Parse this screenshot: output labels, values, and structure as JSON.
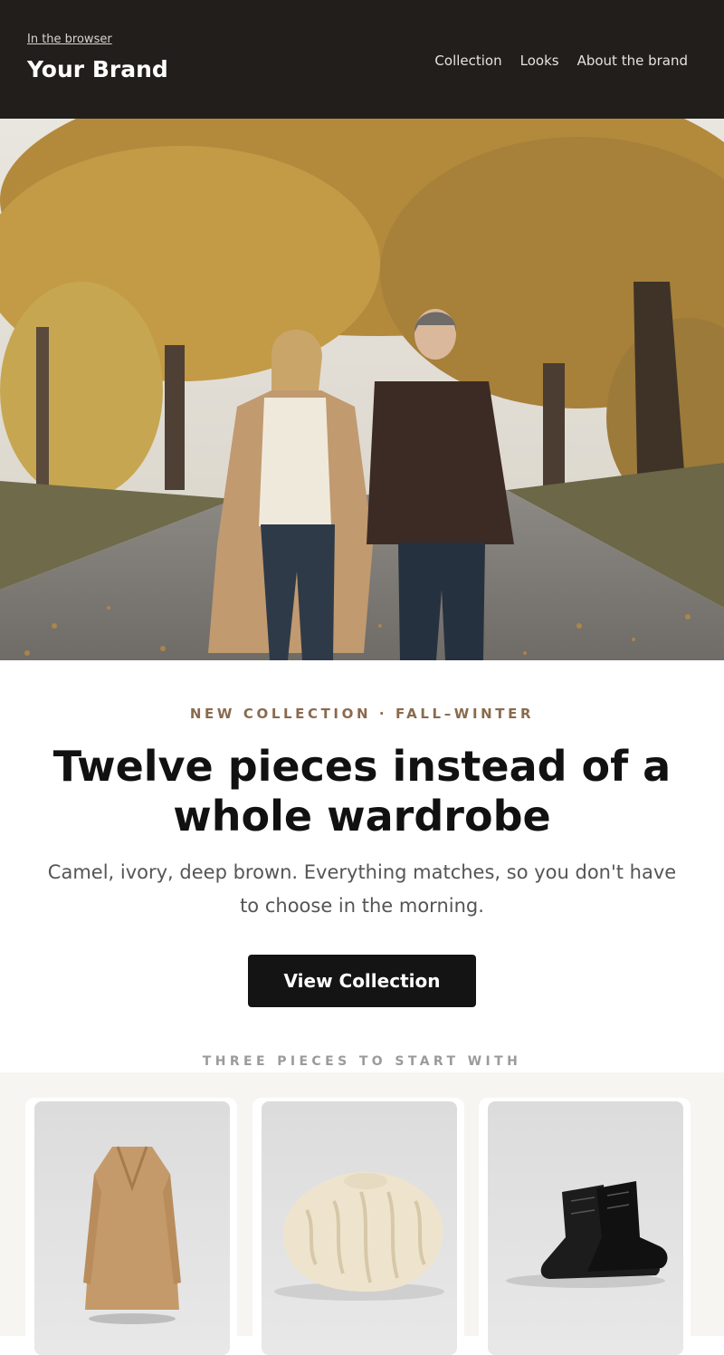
{
  "header": {
    "browser_link": "In the browser",
    "brand": "Your Brand",
    "nav": [
      "Collection",
      "Looks",
      "About the brand"
    ]
  },
  "hero": {
    "eyebrow": "NEW COLLECTION · FALL–WINTER",
    "headline": "Twelve pieces instead of a whole wardrobe",
    "subtitle": "Camel, ivory, deep brown. Everything matches, so you don't have to choose in the morning.",
    "cta": "View Collection"
  },
  "pieces": {
    "label": "THREE PIECES TO START WITH",
    "items": [
      {
        "image": "camel-coat"
      },
      {
        "image": "ivory-cable-sweater"
      },
      {
        "image": "black-leather-boots"
      }
    ]
  },
  "colors": {
    "header_bg": "#221e1c",
    "accent": "#8a6a4e",
    "cta_bg": "#141414",
    "products_bg": "#f7f5f1"
  }
}
